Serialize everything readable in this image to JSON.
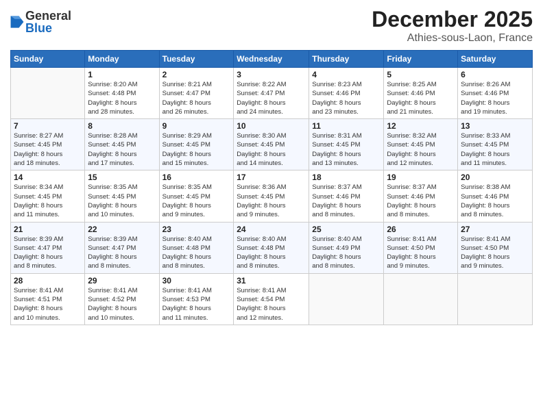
{
  "header": {
    "logo_general": "General",
    "logo_blue": "Blue",
    "title": "December 2025",
    "subtitle": "Athies-sous-Laon, France"
  },
  "weekdays": [
    "Sunday",
    "Monday",
    "Tuesday",
    "Wednesday",
    "Thursday",
    "Friday",
    "Saturday"
  ],
  "weeks": [
    [
      {
        "day": "",
        "info": ""
      },
      {
        "day": "1",
        "info": "Sunrise: 8:20 AM\nSunset: 4:48 PM\nDaylight: 8 hours\nand 28 minutes."
      },
      {
        "day": "2",
        "info": "Sunrise: 8:21 AM\nSunset: 4:47 PM\nDaylight: 8 hours\nand 26 minutes."
      },
      {
        "day": "3",
        "info": "Sunrise: 8:22 AM\nSunset: 4:47 PM\nDaylight: 8 hours\nand 24 minutes."
      },
      {
        "day": "4",
        "info": "Sunrise: 8:23 AM\nSunset: 4:46 PM\nDaylight: 8 hours\nand 23 minutes."
      },
      {
        "day": "5",
        "info": "Sunrise: 8:25 AM\nSunset: 4:46 PM\nDaylight: 8 hours\nand 21 minutes."
      },
      {
        "day": "6",
        "info": "Sunrise: 8:26 AM\nSunset: 4:46 PM\nDaylight: 8 hours\nand 19 minutes."
      }
    ],
    [
      {
        "day": "7",
        "info": "Sunrise: 8:27 AM\nSunset: 4:45 PM\nDaylight: 8 hours\nand 18 minutes."
      },
      {
        "day": "8",
        "info": "Sunrise: 8:28 AM\nSunset: 4:45 PM\nDaylight: 8 hours\nand 17 minutes."
      },
      {
        "day": "9",
        "info": "Sunrise: 8:29 AM\nSunset: 4:45 PM\nDaylight: 8 hours\nand 15 minutes."
      },
      {
        "day": "10",
        "info": "Sunrise: 8:30 AM\nSunset: 4:45 PM\nDaylight: 8 hours\nand 14 minutes."
      },
      {
        "day": "11",
        "info": "Sunrise: 8:31 AM\nSunset: 4:45 PM\nDaylight: 8 hours\nand 13 minutes."
      },
      {
        "day": "12",
        "info": "Sunrise: 8:32 AM\nSunset: 4:45 PM\nDaylight: 8 hours\nand 12 minutes."
      },
      {
        "day": "13",
        "info": "Sunrise: 8:33 AM\nSunset: 4:45 PM\nDaylight: 8 hours\nand 11 minutes."
      }
    ],
    [
      {
        "day": "14",
        "info": "Sunrise: 8:34 AM\nSunset: 4:45 PM\nDaylight: 8 hours\nand 11 minutes."
      },
      {
        "day": "15",
        "info": "Sunrise: 8:35 AM\nSunset: 4:45 PM\nDaylight: 8 hours\nand 10 minutes."
      },
      {
        "day": "16",
        "info": "Sunrise: 8:35 AM\nSunset: 4:45 PM\nDaylight: 8 hours\nand 9 minutes."
      },
      {
        "day": "17",
        "info": "Sunrise: 8:36 AM\nSunset: 4:45 PM\nDaylight: 8 hours\nand 9 minutes."
      },
      {
        "day": "18",
        "info": "Sunrise: 8:37 AM\nSunset: 4:46 PM\nDaylight: 8 hours\nand 8 minutes."
      },
      {
        "day": "19",
        "info": "Sunrise: 8:37 AM\nSunset: 4:46 PM\nDaylight: 8 hours\nand 8 minutes."
      },
      {
        "day": "20",
        "info": "Sunrise: 8:38 AM\nSunset: 4:46 PM\nDaylight: 8 hours\nand 8 minutes."
      }
    ],
    [
      {
        "day": "21",
        "info": "Sunrise: 8:39 AM\nSunset: 4:47 PM\nDaylight: 8 hours\nand 8 minutes."
      },
      {
        "day": "22",
        "info": "Sunrise: 8:39 AM\nSunset: 4:47 PM\nDaylight: 8 hours\nand 8 minutes."
      },
      {
        "day": "23",
        "info": "Sunrise: 8:40 AM\nSunset: 4:48 PM\nDaylight: 8 hours\nand 8 minutes."
      },
      {
        "day": "24",
        "info": "Sunrise: 8:40 AM\nSunset: 4:48 PM\nDaylight: 8 hours\nand 8 minutes."
      },
      {
        "day": "25",
        "info": "Sunrise: 8:40 AM\nSunset: 4:49 PM\nDaylight: 8 hours\nand 8 minutes."
      },
      {
        "day": "26",
        "info": "Sunrise: 8:41 AM\nSunset: 4:50 PM\nDaylight: 8 hours\nand 9 minutes."
      },
      {
        "day": "27",
        "info": "Sunrise: 8:41 AM\nSunset: 4:50 PM\nDaylight: 8 hours\nand 9 minutes."
      }
    ],
    [
      {
        "day": "28",
        "info": "Sunrise: 8:41 AM\nSunset: 4:51 PM\nDaylight: 8 hours\nand 10 minutes."
      },
      {
        "day": "29",
        "info": "Sunrise: 8:41 AM\nSunset: 4:52 PM\nDaylight: 8 hours\nand 10 minutes."
      },
      {
        "day": "30",
        "info": "Sunrise: 8:41 AM\nSunset: 4:53 PM\nDaylight: 8 hours\nand 11 minutes."
      },
      {
        "day": "31",
        "info": "Sunrise: 8:41 AM\nSunset: 4:54 PM\nDaylight: 8 hours\nand 12 minutes."
      },
      {
        "day": "",
        "info": ""
      },
      {
        "day": "",
        "info": ""
      },
      {
        "day": "",
        "info": ""
      }
    ]
  ]
}
